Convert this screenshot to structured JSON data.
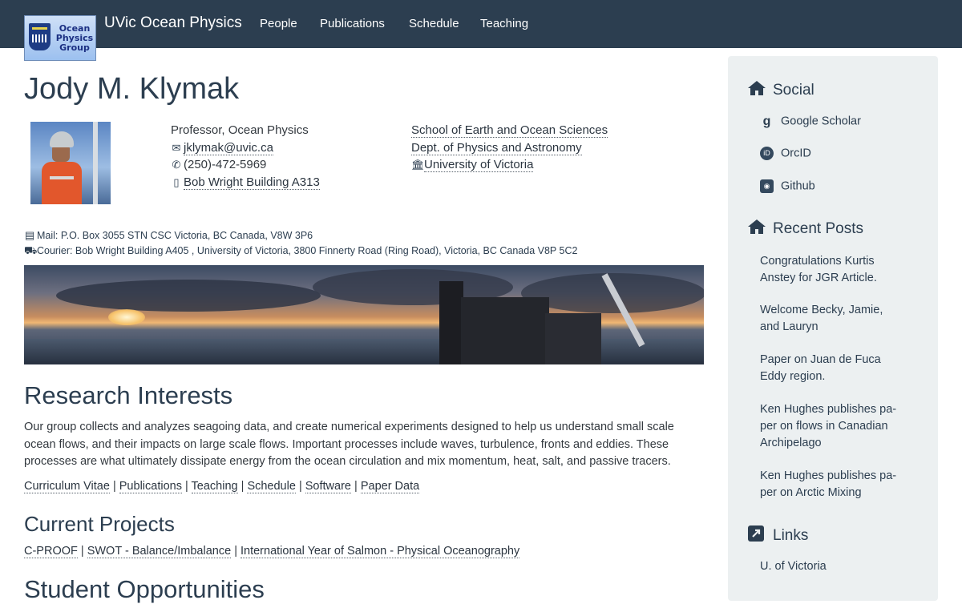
{
  "navbar": {
    "logo_text": [
      "Ocean",
      "Physics",
      "Group"
    ],
    "brand": "UVic Ocean Physics",
    "links": [
      "People",
      "Publications",
      "Schedule",
      "Teaching"
    ]
  },
  "profile": {
    "name": "Jody M. Klymak",
    "title": "Professor, Ocean Physics",
    "email": "jklymak@uvic.ca",
    "phone": "(250)-472-5969",
    "office": "Bob Wright Building A313",
    "affiliations": [
      "School of Earth and Ocean Sciences",
      "Dept. of Physics and Astronomy",
      "University of Victoria"
    ],
    "mail": "Mail: P.O. Box 3055 STN CSC Victoria, BC Canada, V8W 3P6",
    "courier": "Courier: Bob Wright Building A405 , University of Victoria, 3800 Finnerty Road (Ring Road), Victoria, BC Canada V8P 5C2"
  },
  "research": {
    "heading": "Research Interests",
    "text": "Our group collects and analyzes seagoing data, and create numerical experiments designed to help us understand small scale ocean flows, and their impacts on large scale flows. Important processes include waves, turbulence, fronts and eddies. These processes are what ultimately dissipate energy from the ocean circulation and mix momentum, heat, salt, and passive tracers.",
    "links": [
      "Curriculum Vitae",
      "Publications",
      "Teaching",
      "Schedule",
      "Software",
      "Paper Data"
    ]
  },
  "projects": {
    "heading": "Current Projects",
    "links": [
      "C-PROOF",
      "SWOT - Balance/Imbalance",
      "International Year of Salmon - Physical Oceanography"
    ]
  },
  "students": {
    "heading": "Student Opportunities"
  },
  "sidebar": {
    "social_heading": "Social",
    "social": [
      "Google Scholar",
      "OrcID",
      "Github"
    ],
    "posts_heading": "Recent Posts",
    "posts": [
      "Congratulations Kurtis Anstey for JGR Article.",
      "Welcome Becky, Jamie, and Lauryn",
      "Paper on Juan de Fuca Eddy region.",
      "Ken Hughes publishes pa- per on flows in Canadian Archipelago",
      "Ken Hughes publishes pa- per on Arctic Mixing"
    ],
    "links_heading": "Links",
    "links": [
      "U. of Victoria"
    ]
  },
  "icons": {
    "email": "envelope-icon",
    "phone": "phone-icon",
    "office": "building-icon",
    "university": "institution-icon",
    "mail": "id-card-icon",
    "courier": "truck-icon",
    "social": "home-icon",
    "posts": "home-icon",
    "links": "external-link-icon"
  },
  "colors": {
    "navbar": "#2c3e50",
    "sidebar": "#ecf0f1",
    "text": "#2c3e50"
  }
}
